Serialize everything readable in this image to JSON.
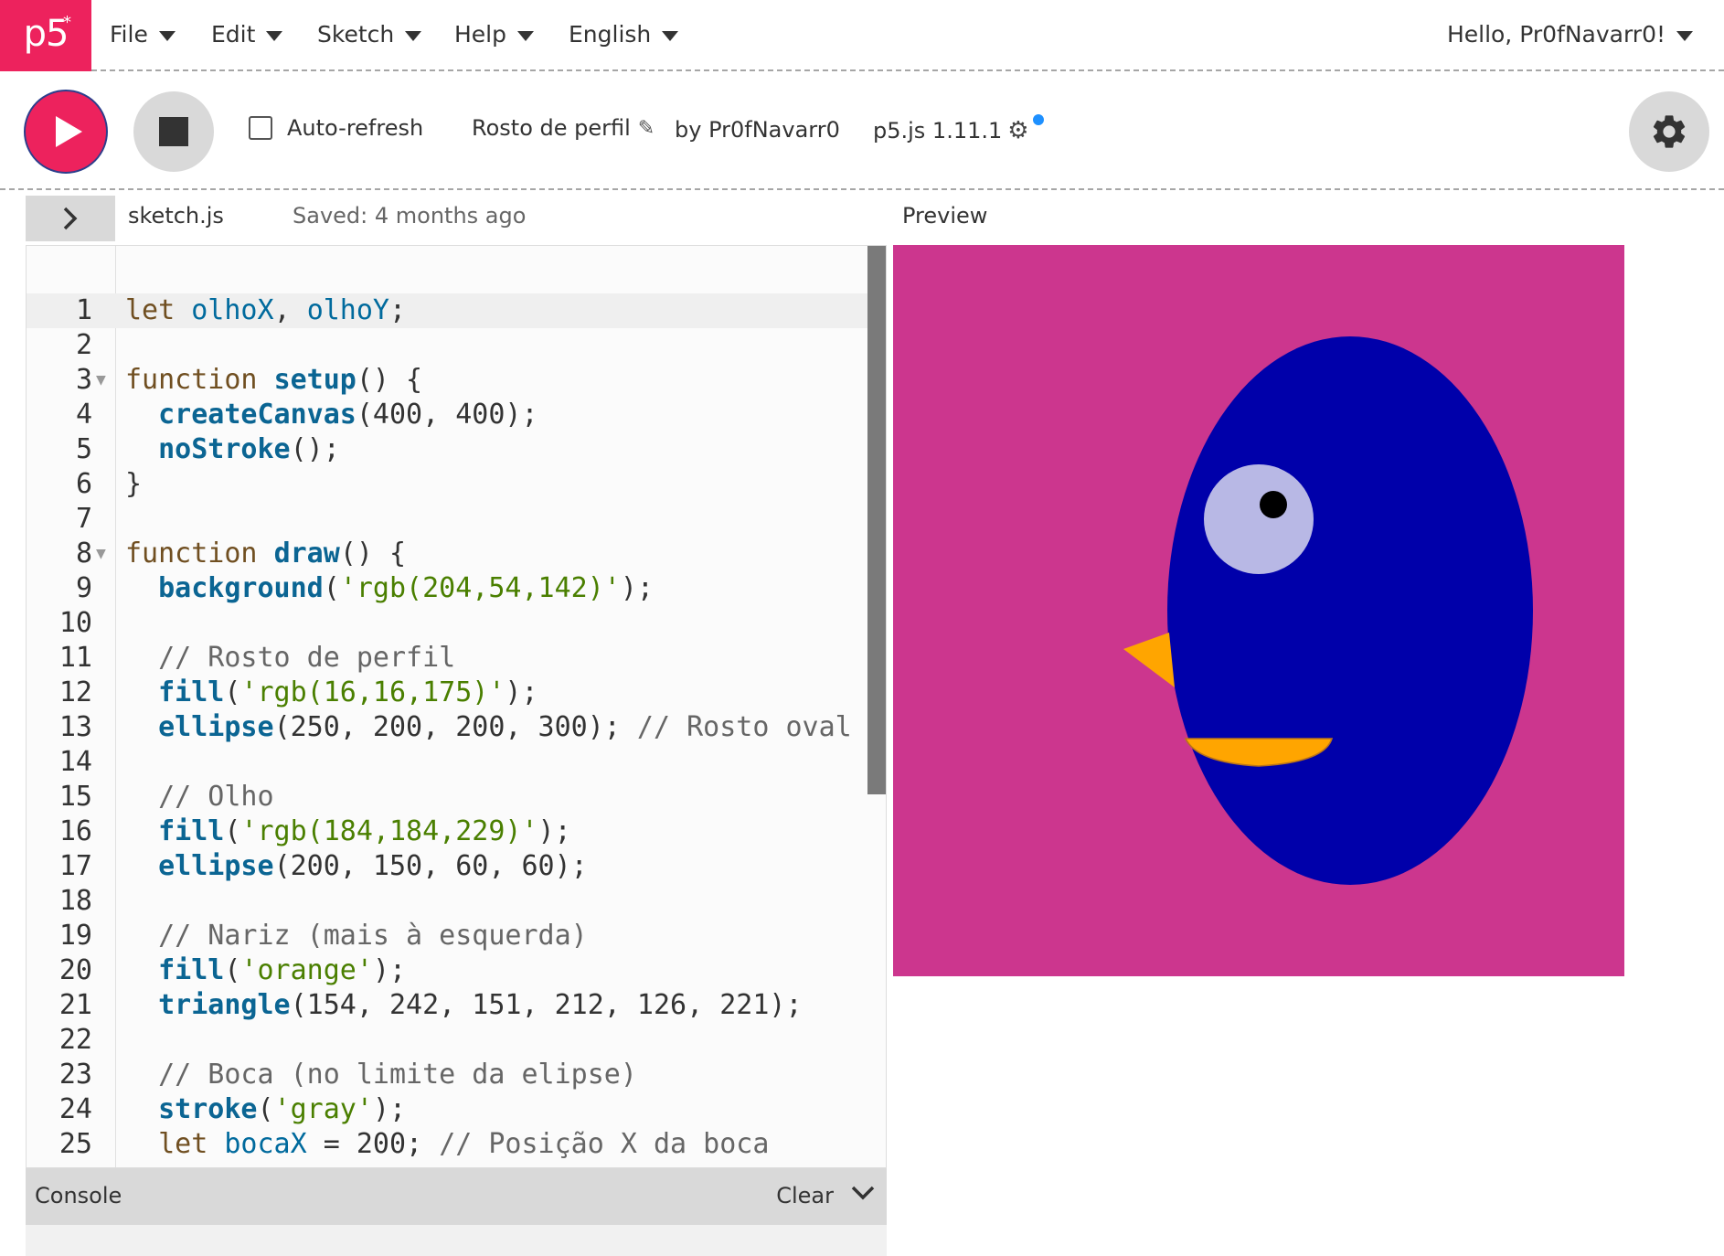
{
  "nav": {
    "logo_text": "p5",
    "logo_star": "*",
    "menus": [
      "File",
      "Edit",
      "Sketch",
      "Help",
      "English"
    ],
    "user": "Hello, Pr0fNavarr0!"
  },
  "toolbar": {
    "autorefresh_label": "Auto-refresh",
    "autorefresh_checked": false,
    "sketch_name": "Rosto de perfil",
    "by_author": "by Pr0fNavarr0",
    "version": "p5.js 1.11.1",
    "play_icon": "play-icon",
    "stop_icon": "stop-icon",
    "settings_icon": "gear-icon"
  },
  "editor": {
    "file_name": "sketch.js",
    "saved": "Saved: 4 months ago",
    "active_line": 1,
    "lines": [
      {
        "n": "1",
        "fold": false,
        "tokens": [
          [
            "kw",
            "let "
          ],
          [
            "var",
            "olhoX"
          ],
          [
            "p",
            ", "
          ],
          [
            "var",
            "olhoY"
          ],
          [
            "p",
            ";"
          ]
        ]
      },
      {
        "n": "2",
        "fold": false,
        "tokens": []
      },
      {
        "n": "3",
        "fold": true,
        "tokens": [
          [
            "kw",
            "function "
          ],
          [
            "fn",
            "setup"
          ],
          [
            "p",
            "() {"
          ]
        ]
      },
      {
        "n": "4",
        "fold": false,
        "tokens": [
          [
            "p",
            "  "
          ],
          [
            "fn",
            "createCanvas"
          ],
          [
            "p",
            "(400, 400);"
          ]
        ]
      },
      {
        "n": "5",
        "fold": false,
        "tokens": [
          [
            "p",
            "  "
          ],
          [
            "fn",
            "noStroke"
          ],
          [
            "p",
            "();"
          ]
        ]
      },
      {
        "n": "6",
        "fold": false,
        "tokens": [
          [
            "p",
            "}"
          ]
        ]
      },
      {
        "n": "7",
        "fold": false,
        "tokens": []
      },
      {
        "n": "8",
        "fold": true,
        "tokens": [
          [
            "kw",
            "function "
          ],
          [
            "fn",
            "draw"
          ],
          [
            "p",
            "() {"
          ]
        ]
      },
      {
        "n": "9",
        "fold": false,
        "tokens": [
          [
            "p",
            "  "
          ],
          [
            "fn",
            "background"
          ],
          [
            "p",
            "("
          ],
          [
            "str",
            "'rgb(204,54,142)'"
          ],
          [
            "p",
            ");"
          ]
        ]
      },
      {
        "n": "10",
        "fold": false,
        "tokens": []
      },
      {
        "n": "11",
        "fold": false,
        "tokens": [
          [
            "p",
            "  "
          ],
          [
            "cm",
            "// Rosto de perfil"
          ]
        ]
      },
      {
        "n": "12",
        "fold": false,
        "tokens": [
          [
            "p",
            "  "
          ],
          [
            "fn",
            "fill"
          ],
          [
            "p",
            "("
          ],
          [
            "str",
            "'rgb(16,16,175)'"
          ],
          [
            "p",
            ");"
          ]
        ]
      },
      {
        "n": "13",
        "fold": false,
        "tokens": [
          [
            "p",
            "  "
          ],
          [
            "fn",
            "ellipse"
          ],
          [
            "p",
            "(250, 200, 200, 300); "
          ],
          [
            "cm",
            "// Rosto oval"
          ]
        ]
      },
      {
        "n": "14",
        "fold": false,
        "tokens": []
      },
      {
        "n": "15",
        "fold": false,
        "tokens": [
          [
            "p",
            "  "
          ],
          [
            "cm",
            "// Olho"
          ]
        ]
      },
      {
        "n": "16",
        "fold": false,
        "tokens": [
          [
            "p",
            "  "
          ],
          [
            "fn",
            "fill"
          ],
          [
            "p",
            "("
          ],
          [
            "str",
            "'rgb(184,184,229)'"
          ],
          [
            "p",
            ");"
          ]
        ]
      },
      {
        "n": "17",
        "fold": false,
        "tokens": [
          [
            "p",
            "  "
          ],
          [
            "fn",
            "ellipse"
          ],
          [
            "p",
            "(200, 150, 60, 60);"
          ]
        ]
      },
      {
        "n": "18",
        "fold": false,
        "tokens": []
      },
      {
        "n": "19",
        "fold": false,
        "tokens": [
          [
            "p",
            "  "
          ],
          [
            "cm",
            "// Nariz (mais à esquerda)"
          ]
        ]
      },
      {
        "n": "20",
        "fold": false,
        "tokens": [
          [
            "p",
            "  "
          ],
          [
            "fn",
            "fill"
          ],
          [
            "p",
            "("
          ],
          [
            "str",
            "'orange'"
          ],
          [
            "p",
            ");"
          ]
        ]
      },
      {
        "n": "21",
        "fold": false,
        "tokens": [
          [
            "p",
            "  "
          ],
          [
            "fn",
            "triangle"
          ],
          [
            "p",
            "(154, 242, 151, 212, 126, 221);"
          ]
        ]
      },
      {
        "n": "22",
        "fold": false,
        "tokens": []
      },
      {
        "n": "23",
        "fold": false,
        "tokens": [
          [
            "p",
            "  "
          ],
          [
            "cm",
            "// Boca (no limite da elipse)"
          ]
        ]
      },
      {
        "n": "24",
        "fold": false,
        "tokens": [
          [
            "p",
            "  "
          ],
          [
            "fn",
            "stroke"
          ],
          [
            "p",
            "("
          ],
          [
            "str",
            "'gray'"
          ],
          [
            "p",
            ");"
          ]
        ]
      },
      {
        "n": "25",
        "fold": false,
        "tokens": [
          [
            "p",
            "  "
          ],
          [
            "kw",
            "let "
          ],
          [
            "var",
            "bocaX"
          ],
          [
            "p",
            " = 200; "
          ],
          [
            "cm",
            "// Posição X da boca"
          ]
        ]
      }
    ],
    "colors": {
      "kw": "#704f21",
      "var": "#006a9d",
      "fn": "#0b6593",
      "str": "#4a7f00",
      "cm": "#666666",
      "p": "#333333"
    }
  },
  "preview": {
    "label": "Preview",
    "background": "#cc368e",
    "face_color": "#0000aa",
    "eye_color": "#b8b8e5",
    "pupil_color": "#000000",
    "nose_color": "#ffa500",
    "mouth_color": "#ffa500"
  },
  "console": {
    "title": "Console",
    "clear_label": "Clear"
  }
}
